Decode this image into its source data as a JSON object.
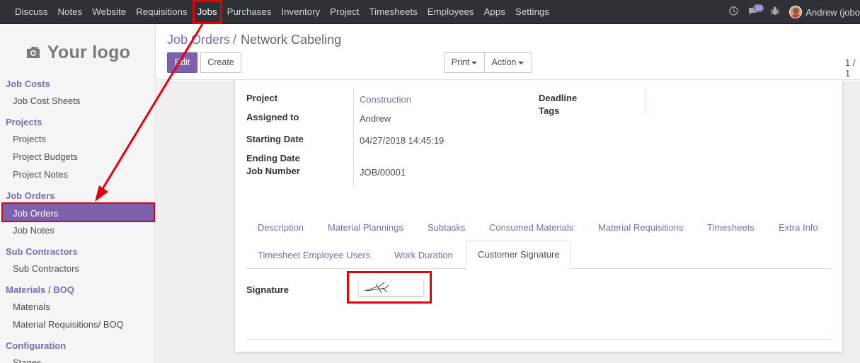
{
  "topbar": {
    "menu": [
      "Discuss",
      "Notes",
      "Website",
      "Requisitions",
      "Jobs",
      "Purchases",
      "Inventory",
      "Project",
      "Timesheets",
      "Employees",
      "Apps",
      "Settings"
    ],
    "active_menu": "Jobs",
    "messages_count": "10",
    "user_name": "Andrew (jobo"
  },
  "sidebar": {
    "logo_text": "Your logo",
    "sections": [
      {
        "title": "Job Costs",
        "items": [
          "Job Cost Sheets"
        ]
      },
      {
        "title": "Projects",
        "items": [
          "Projects",
          "Project Budgets",
          "Project Notes"
        ]
      },
      {
        "title": "Job Orders",
        "items": [
          "Job Orders",
          "Job Notes"
        ]
      },
      {
        "title": "Sub Contractors",
        "items": [
          "Sub Contractors"
        ]
      },
      {
        "title": "Materials / BOQ",
        "items": [
          "Materials",
          "Material Requisitions/ BOQ"
        ]
      },
      {
        "title": "Configuration",
        "items": [
          "Stages"
        ]
      }
    ],
    "selected_item": "Job Orders"
  },
  "breadcrumb": {
    "parent": "Job Orders",
    "separator": "/",
    "current": "Network Cabeling"
  },
  "buttons": {
    "edit": "Edit",
    "create": "Create",
    "print": "Print",
    "action": "Action"
  },
  "pager": "1 / 1",
  "form": {
    "project_label": "Project",
    "project_value": "Construction",
    "assigned_label": "Assigned to",
    "assigned_value": "Andrew",
    "start_label": "Starting Date",
    "start_value": "04/27/2018 14:45:19",
    "end_label": "Ending Date",
    "jobnum_label": "Job Number",
    "jobnum_value": "JOB/00001",
    "deadline_label": "Deadline",
    "tags_label": "Tags",
    "tabs_row1": [
      "Description",
      "Material Plannings",
      "Subtasks",
      "Consumed Materials",
      "Material Requisitions",
      "Timesheets",
      "Extra Info"
    ],
    "tabs_row2": [
      "Timesheet Employee Users",
      "Work Duration",
      "Customer Signature"
    ],
    "active_tab": "Customer Signature",
    "signature_label": "Signature"
  },
  "colors": {
    "accent": "#7c6bb0",
    "primary_button": "#7c62ad",
    "highlight": "#e3000b",
    "navbar": "#2f3136"
  }
}
